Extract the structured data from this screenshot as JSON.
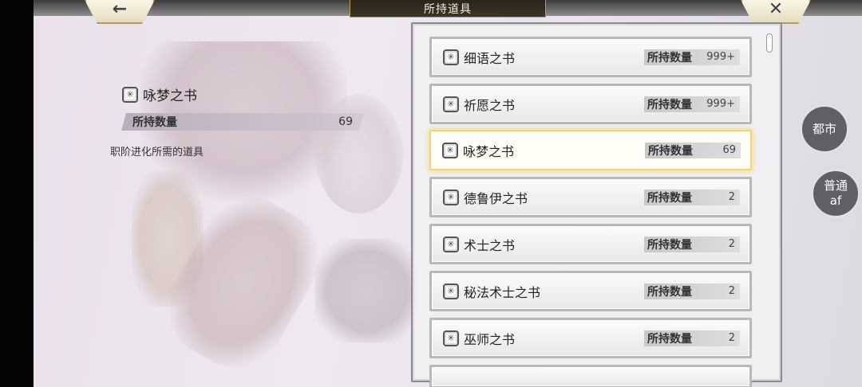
{
  "header": {
    "title": "所持道具",
    "back_glyph": "←",
    "close_glyph": "✕"
  },
  "detail": {
    "name": "咏梦之书",
    "count_label": "所持数量",
    "count_value": "69",
    "description": "职阶进化所需的道具"
  },
  "items": [
    {
      "name": "细语之书",
      "count_label": "所持数量",
      "count": "999+"
    },
    {
      "name": "祈愿之书",
      "count_label": "所持数量",
      "count": "999+"
    },
    {
      "name": "咏梦之书",
      "count_label": "所持数量",
      "count": "69",
      "selected": true
    },
    {
      "name": "德鲁伊之书",
      "count_label": "所持数量",
      "count": "2"
    },
    {
      "name": "术士之书",
      "count_label": "所持数量",
      "count": "2"
    },
    {
      "name": "秘法术士之书",
      "count_label": "所持数量",
      "count": "2"
    },
    {
      "name": "巫师之书",
      "count_label": "所持数量",
      "count": "2"
    }
  ],
  "side_buttons": {
    "city": "都市",
    "normal_line1": "普通",
    "normal_line2": "af"
  },
  "icons": {
    "item_icon": "book-icon",
    "book_glyph": "✳"
  },
  "colors": {
    "selected_glow": "#f6dfa1",
    "frame_gold": "#b79a52",
    "title_bg": "#2a241c"
  }
}
